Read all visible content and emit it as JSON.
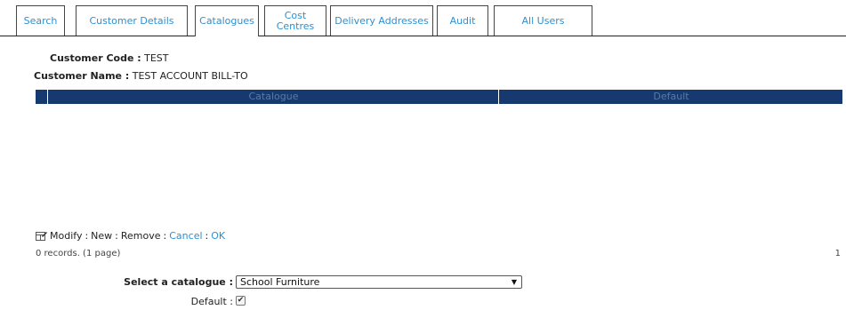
{
  "tabs": [
    {
      "label": "Search"
    },
    {
      "label": "Customer Details"
    },
    {
      "label": "Catalogues"
    },
    {
      "label": "Cost\nCentres"
    },
    {
      "label": "Delivery Addresses"
    },
    {
      "label": "Audit"
    },
    {
      "label": "All Users"
    }
  ],
  "active_tab": "Catalogues",
  "customer": {
    "code_label": "Customer Code :",
    "code_value": "TEST",
    "name_label": "Customer Name :",
    "name_value": "TEST ACCOUNT BILL-TO"
  },
  "grid": {
    "columns": [
      "Catalogue",
      "Default"
    ],
    "rows": []
  },
  "actions": {
    "modify": "Modify",
    "new": "New",
    "remove": "Remove",
    "cancel": "Cancel",
    "ok": "OK",
    "separator": ":"
  },
  "records_text": "0 records. (1 page)",
  "page_number": "1",
  "form": {
    "catalogue_label": "Select a catalogue :",
    "catalogue_value": "School Furniture",
    "default_label": "Default :",
    "default_checked": true
  },
  "colors": {
    "link": "#2f8fd0",
    "grid_header": "#163a6f"
  }
}
